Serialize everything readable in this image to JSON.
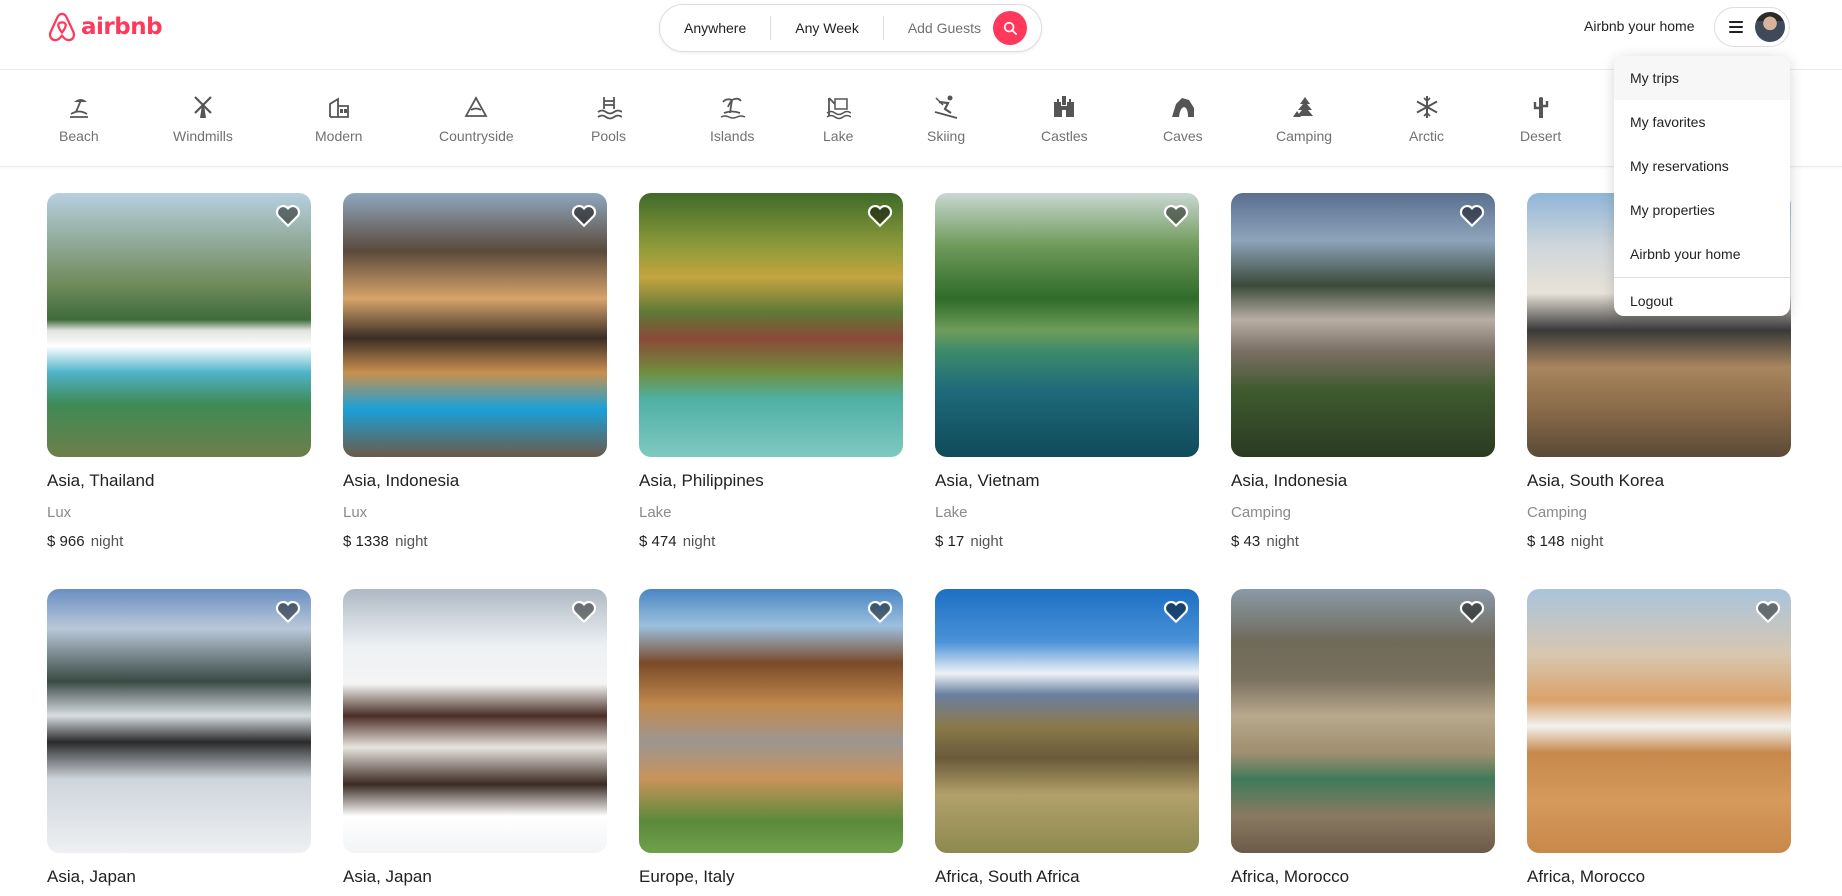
{
  "brand": {
    "name": "airbnb",
    "accent": "#ff385c"
  },
  "search": {
    "where": "Anywhere",
    "when": "Any Week",
    "guests": "Add Guests",
    "button_icon": "search-icon"
  },
  "header": {
    "host_link": "Airbnb your home",
    "menu_icon": "hamburger-icon"
  },
  "categories": [
    {
      "label": "Beach",
      "icon": "beach-icon"
    },
    {
      "label": "Windmills",
      "icon": "windmill-icon"
    },
    {
      "label": "Modern",
      "icon": "modern-house-icon"
    },
    {
      "label": "Countryside",
      "icon": "mountain-icon"
    },
    {
      "label": "Pools",
      "icon": "pool-icon"
    },
    {
      "label": "Islands",
      "icon": "island-icon"
    },
    {
      "label": "Lake",
      "icon": "lake-icon"
    },
    {
      "label": "Skiing",
      "icon": "skiing-icon"
    },
    {
      "label": "Castles",
      "icon": "castle-icon"
    },
    {
      "label": "Caves",
      "icon": "cave-icon"
    },
    {
      "label": "Camping",
      "icon": "camping-icon"
    },
    {
      "label": "Arctic",
      "icon": "snowflake-icon"
    },
    {
      "label": "Desert",
      "icon": "cactus-icon"
    }
  ],
  "listings": [
    {
      "location": "Asia, Thailand",
      "category": "Lux",
      "price": "$ 966",
      "unit": "night"
    },
    {
      "location": "Asia, Indonesia",
      "category": "Lux",
      "price": "$ 1338",
      "unit": "night"
    },
    {
      "location": "Asia, Philippines",
      "category": "Lake",
      "price": "$ 474",
      "unit": "night"
    },
    {
      "location": "Asia, Vietnam",
      "category": "Lake",
      "price": "$ 17",
      "unit": "night"
    },
    {
      "location": "Asia, Indonesia",
      "category": "Camping",
      "price": "$ 43",
      "unit": "night"
    },
    {
      "location": "Asia, South Korea",
      "category": "Camping",
      "price": "$ 148",
      "unit": "night"
    },
    {
      "location": "Asia, Japan"
    },
    {
      "location": "Asia, Japan"
    },
    {
      "location": "Europe, Italy"
    },
    {
      "location": "Africa, South Africa"
    },
    {
      "location": "Africa, Morocco"
    },
    {
      "location": "Africa, Morocco"
    }
  ],
  "user_menu": {
    "items": [
      "My trips",
      "My favorites",
      "My reservations",
      "My properties",
      "Airbnb your home",
      "Logout"
    ]
  }
}
